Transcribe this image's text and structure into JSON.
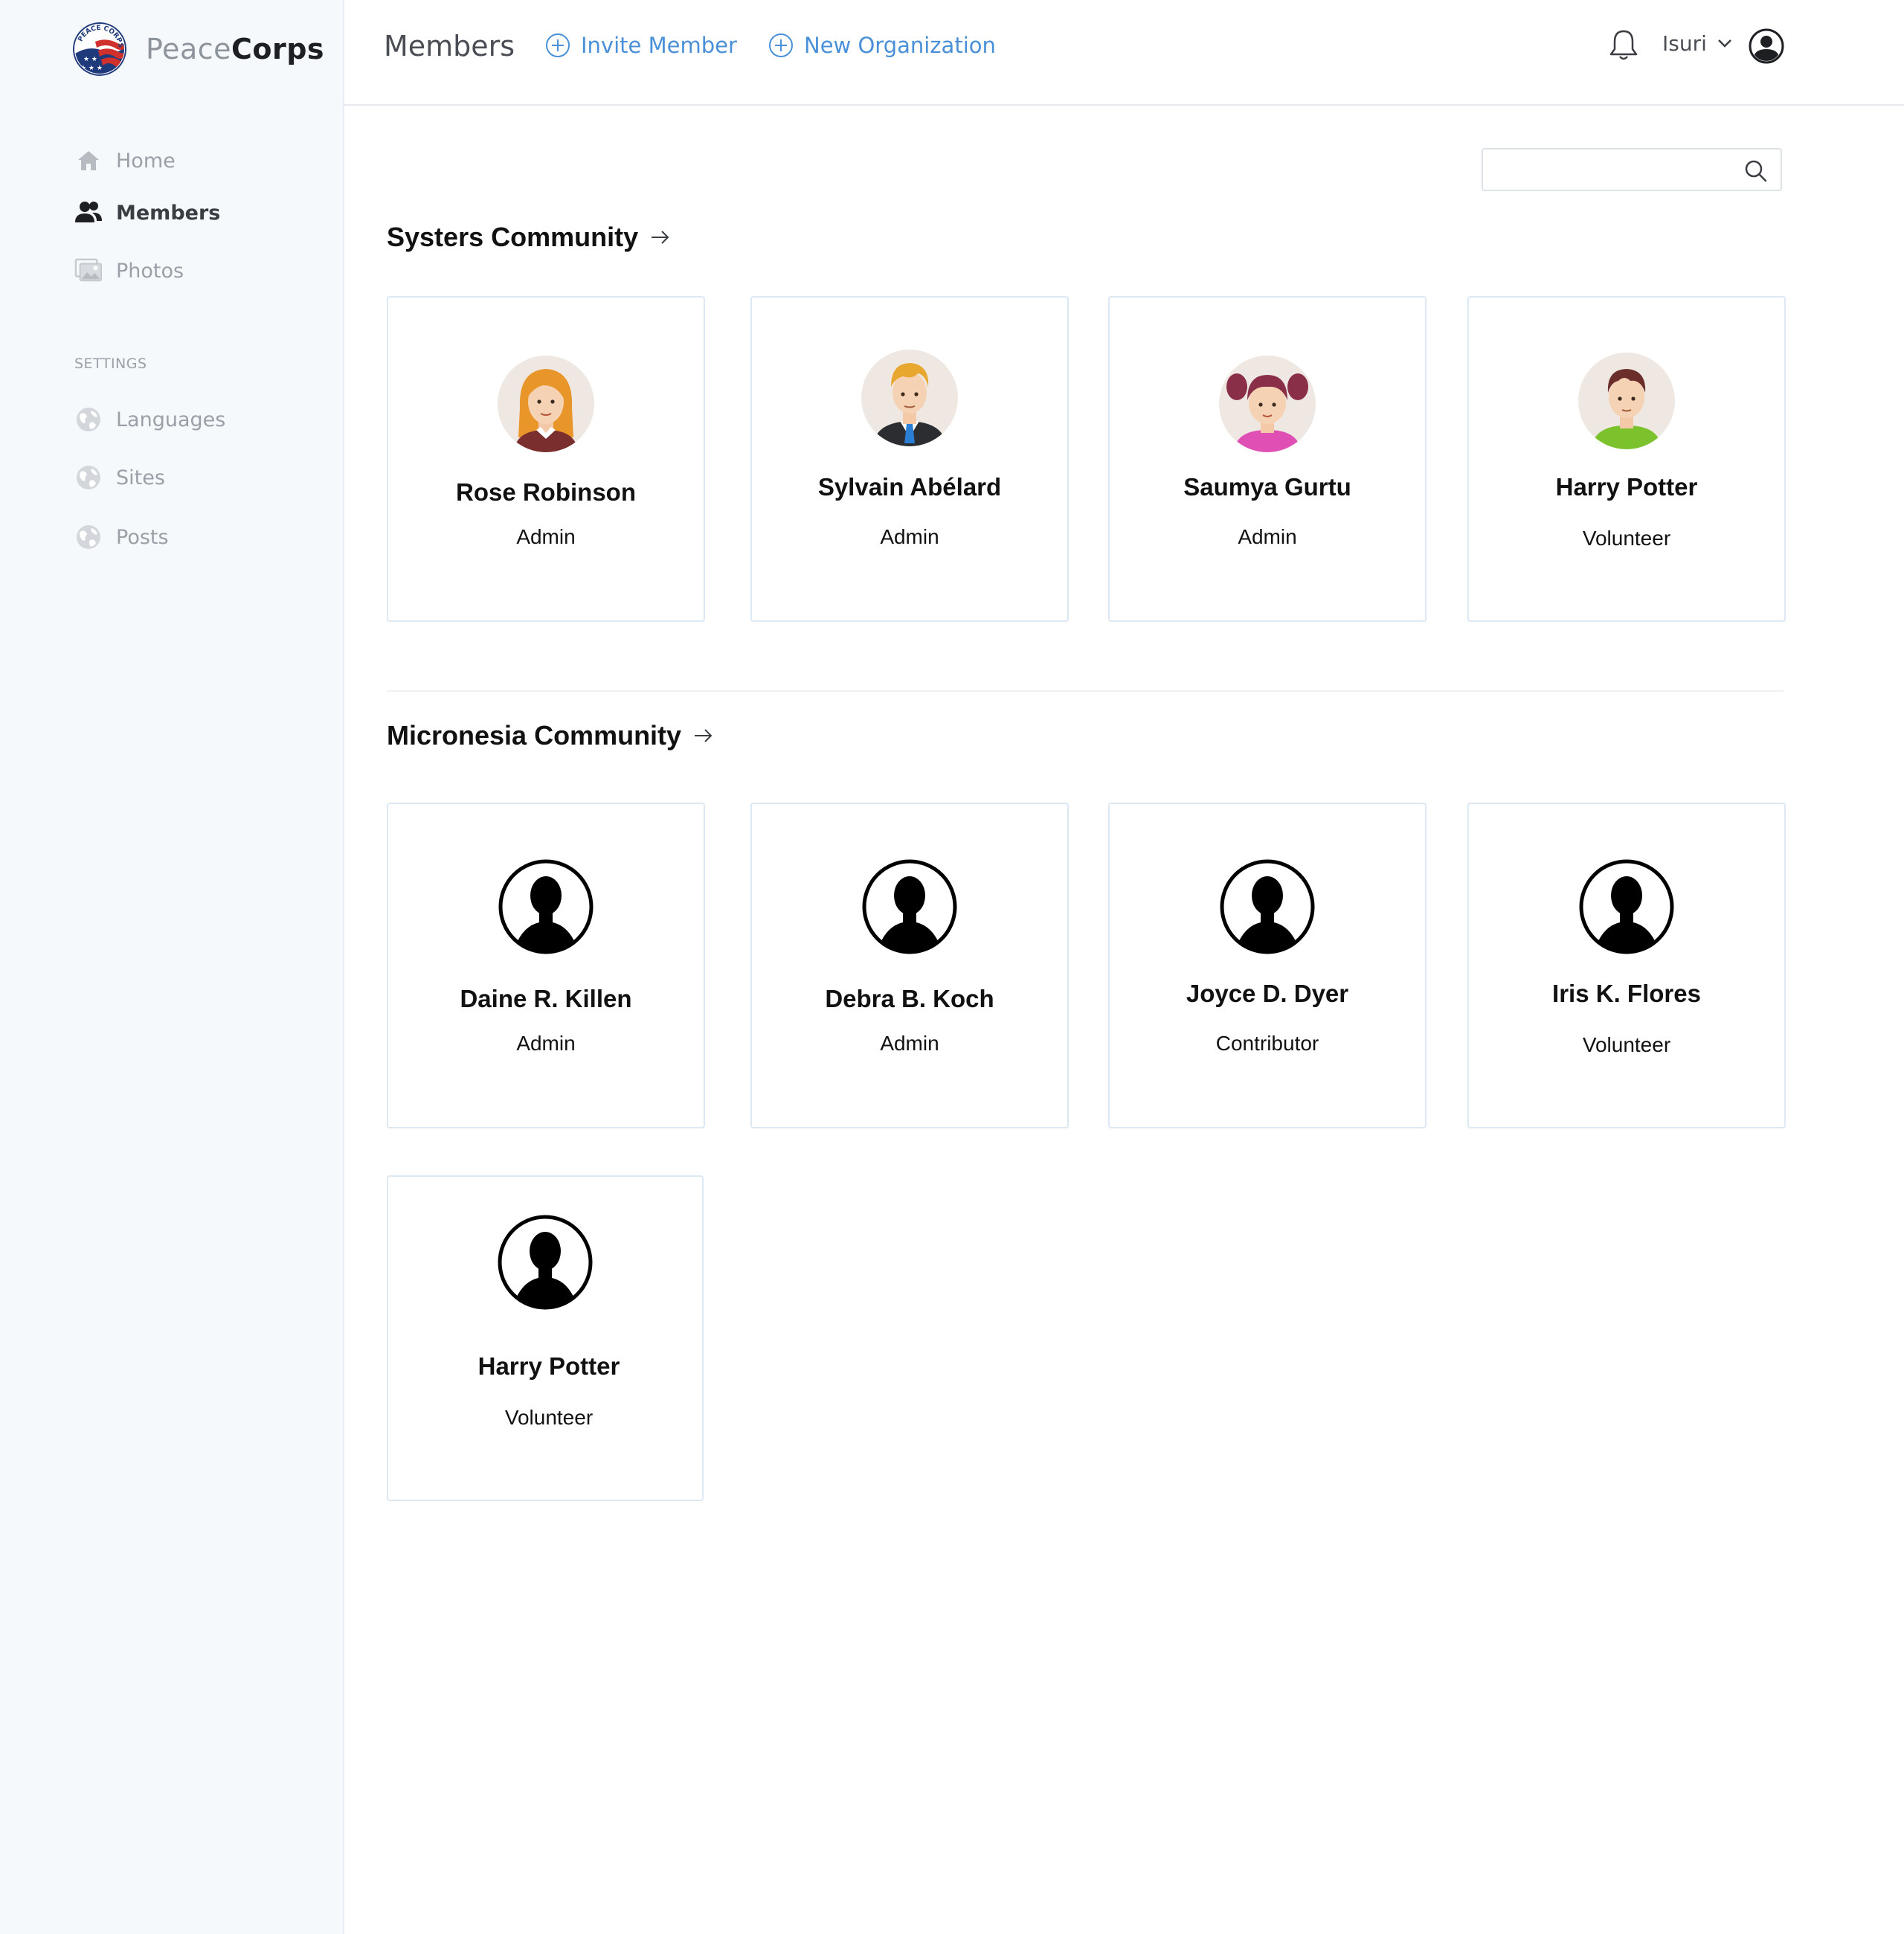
{
  "brand": {
    "part1": "Peace",
    "part2": "Corps"
  },
  "sidebar": {
    "items": [
      {
        "label": "Home",
        "icon": "home-icon"
      },
      {
        "label": "Members",
        "icon": "members-icon",
        "active": true
      },
      {
        "label": "Photos",
        "icon": "photos-icon"
      }
    ],
    "settings_label": "SETTINGS",
    "settings_items": [
      {
        "label": "Languages",
        "icon": "globe-icon"
      },
      {
        "label": "Sites",
        "icon": "globe-icon"
      },
      {
        "label": "Posts",
        "icon": "globe-icon"
      }
    ]
  },
  "header": {
    "title": "Members",
    "invite_label": "Invite Member",
    "new_org_label": "New Organization",
    "user_name": "Isuri"
  },
  "search": {
    "value": "",
    "placeholder": ""
  },
  "sections": [
    {
      "title": "Systers Community",
      "members": [
        {
          "name": "Rose Robinson",
          "role": "Admin",
          "avatar": "woman-orange-hair"
        },
        {
          "name": "Sylvain Abélard",
          "role": "Admin",
          "avatar": "man-suit-blond"
        },
        {
          "name": "Saumya Gurtu",
          "role": "Admin",
          "avatar": "girl-pigtails"
        },
        {
          "name": "Harry Potter",
          "role": "Volunteer",
          "avatar": "boy-green-shirt"
        }
      ]
    },
    {
      "title": "Micronesia Community",
      "members": [
        {
          "name": "Daine R. Killen",
          "role": "Admin",
          "avatar": "silhouette"
        },
        {
          "name": "Debra B. Koch",
          "role": "Admin",
          "avatar": "silhouette"
        },
        {
          "name": "Joyce D. Dyer",
          "role": "Contributor",
          "avatar": "silhouette"
        },
        {
          "name": "Iris K. Flores",
          "role": "Volunteer",
          "avatar": "silhouette"
        },
        {
          "name": "Harry Potter",
          "role": "Volunteer",
          "avatar": "silhouette"
        }
      ]
    }
  ],
  "colors": {
    "accent": "#4a90d9",
    "sidebar_bg": "#f6f9fc",
    "card_border": "#dce8f3"
  }
}
